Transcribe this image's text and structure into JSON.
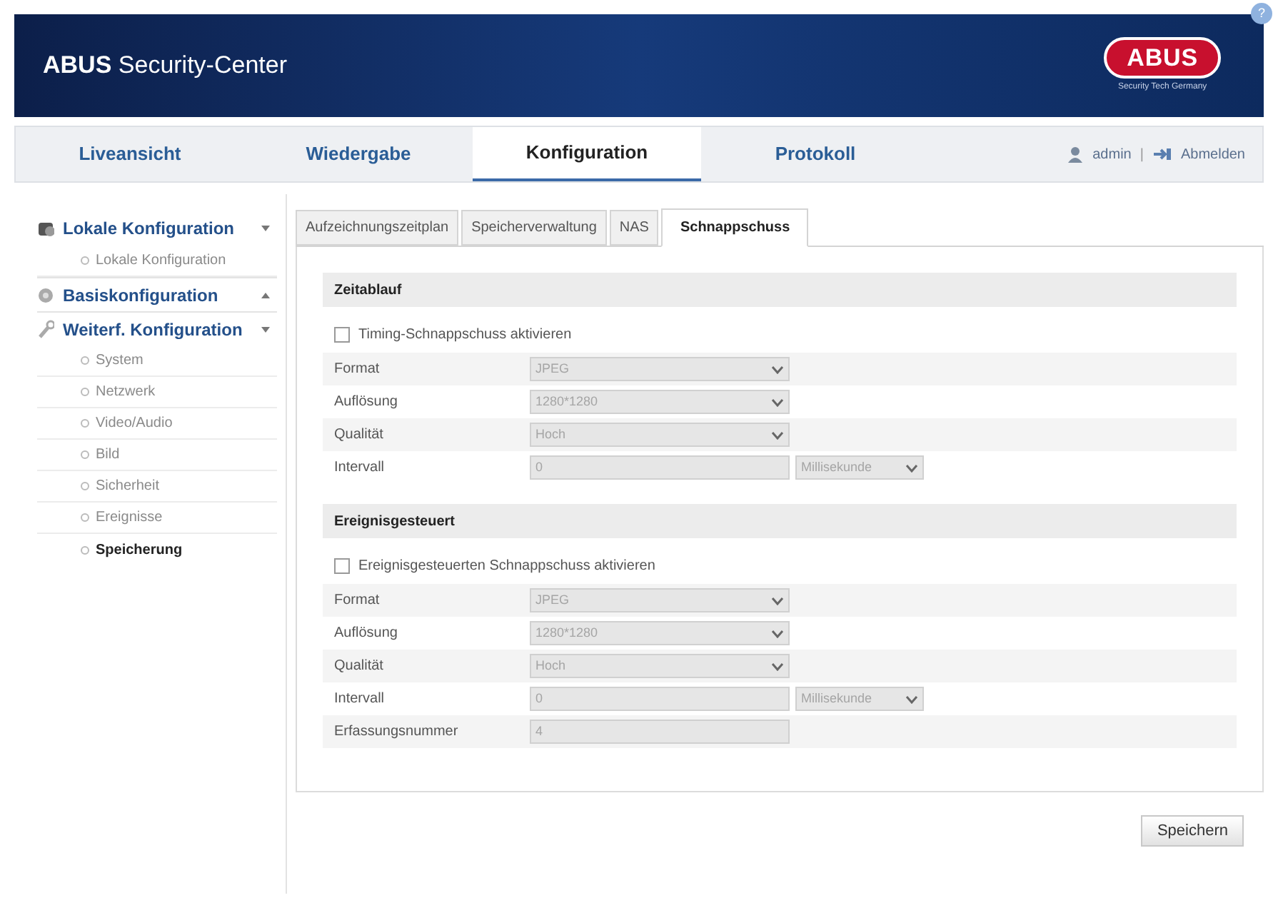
{
  "header": {
    "title": "**ABUS** Security-Center",
    "logo": "ABUS",
    "tagline": "Security Tech Germany",
    "help": "?"
  },
  "nav": {
    "tabs": [
      {
        "label": "Liveansicht",
        "selected": false
      },
      {
        "label": "Wiedergabe",
        "selected": false
      },
      {
        "label": "Konfiguration",
        "selected": true
      },
      {
        "label": "Protokoll",
        "selected": false
      }
    ],
    "user": "admin",
    "separator": "|",
    "logout": "Abmelden"
  },
  "sidebar": {
    "groups": [
      {
        "label": "Lokale Konfiguration",
        "expanded": true,
        "children": [
          {
            "label": "Lokale Konfiguration",
            "selected": false
          }
        ]
      },
      {
        "label": "Basiskonfiguration",
        "expanded": false
      },
      {
        "label": "Weiterf. Konfiguration",
        "expanded": true,
        "children": [
          {
            "label": "System",
            "selected": false
          },
          {
            "label": "Netzwerk",
            "selected": false
          },
          {
            "label": "Video/Audio",
            "selected": false
          },
          {
            "label": "Bild",
            "selected": false
          },
          {
            "label": "Sicherheit",
            "selected": false
          },
          {
            "label": "Ereignisse",
            "selected": false
          },
          {
            "label": "Speicherung",
            "selected": true
          }
        ]
      }
    ]
  },
  "tabs": [
    {
      "label": "Aufzeichnungszeitplan",
      "selected": false
    },
    {
      "label": "Speicherverwaltung",
      "selected": false
    },
    {
      "label": "NAS",
      "selected": false
    },
    {
      "label": "Schnappschuss",
      "selected": true
    }
  ],
  "sections": [
    {
      "title": "Zeitablauf",
      "checkbox": {
        "label": "Timing-Schnappschuss aktivieren",
        "checked": false
      },
      "rows": [
        {
          "label": "Format",
          "kind": "select",
          "value": "JPEG"
        },
        {
          "label": "Auflösung",
          "kind": "select",
          "value": "1280*1280"
        },
        {
          "label": "Qualität",
          "kind": "select",
          "value": "Hoch"
        },
        {
          "label": "Intervall",
          "kind": "input",
          "value": "0",
          "unit": "Millisekunde"
        }
      ]
    },
    {
      "title": "Ereignisgesteuert",
      "checkbox": {
        "label": "Ereignisgesteuerten Schnappschuss aktivieren",
        "checked": false
      },
      "rows": [
        {
          "label": "Format",
          "kind": "select",
          "value": "JPEG"
        },
        {
          "label": "Auflösung",
          "kind": "select",
          "value": "1280*1280"
        },
        {
          "label": "Qualität",
          "kind": "select",
          "value": "Hoch"
        },
        {
          "label": "Intervall",
          "kind": "input",
          "value": "0",
          "unit": "Millisekunde"
        },
        {
          "label": "Erfassungsnummer",
          "kind": "input",
          "value": "4"
        }
      ]
    }
  ],
  "save_button": "Speichern"
}
